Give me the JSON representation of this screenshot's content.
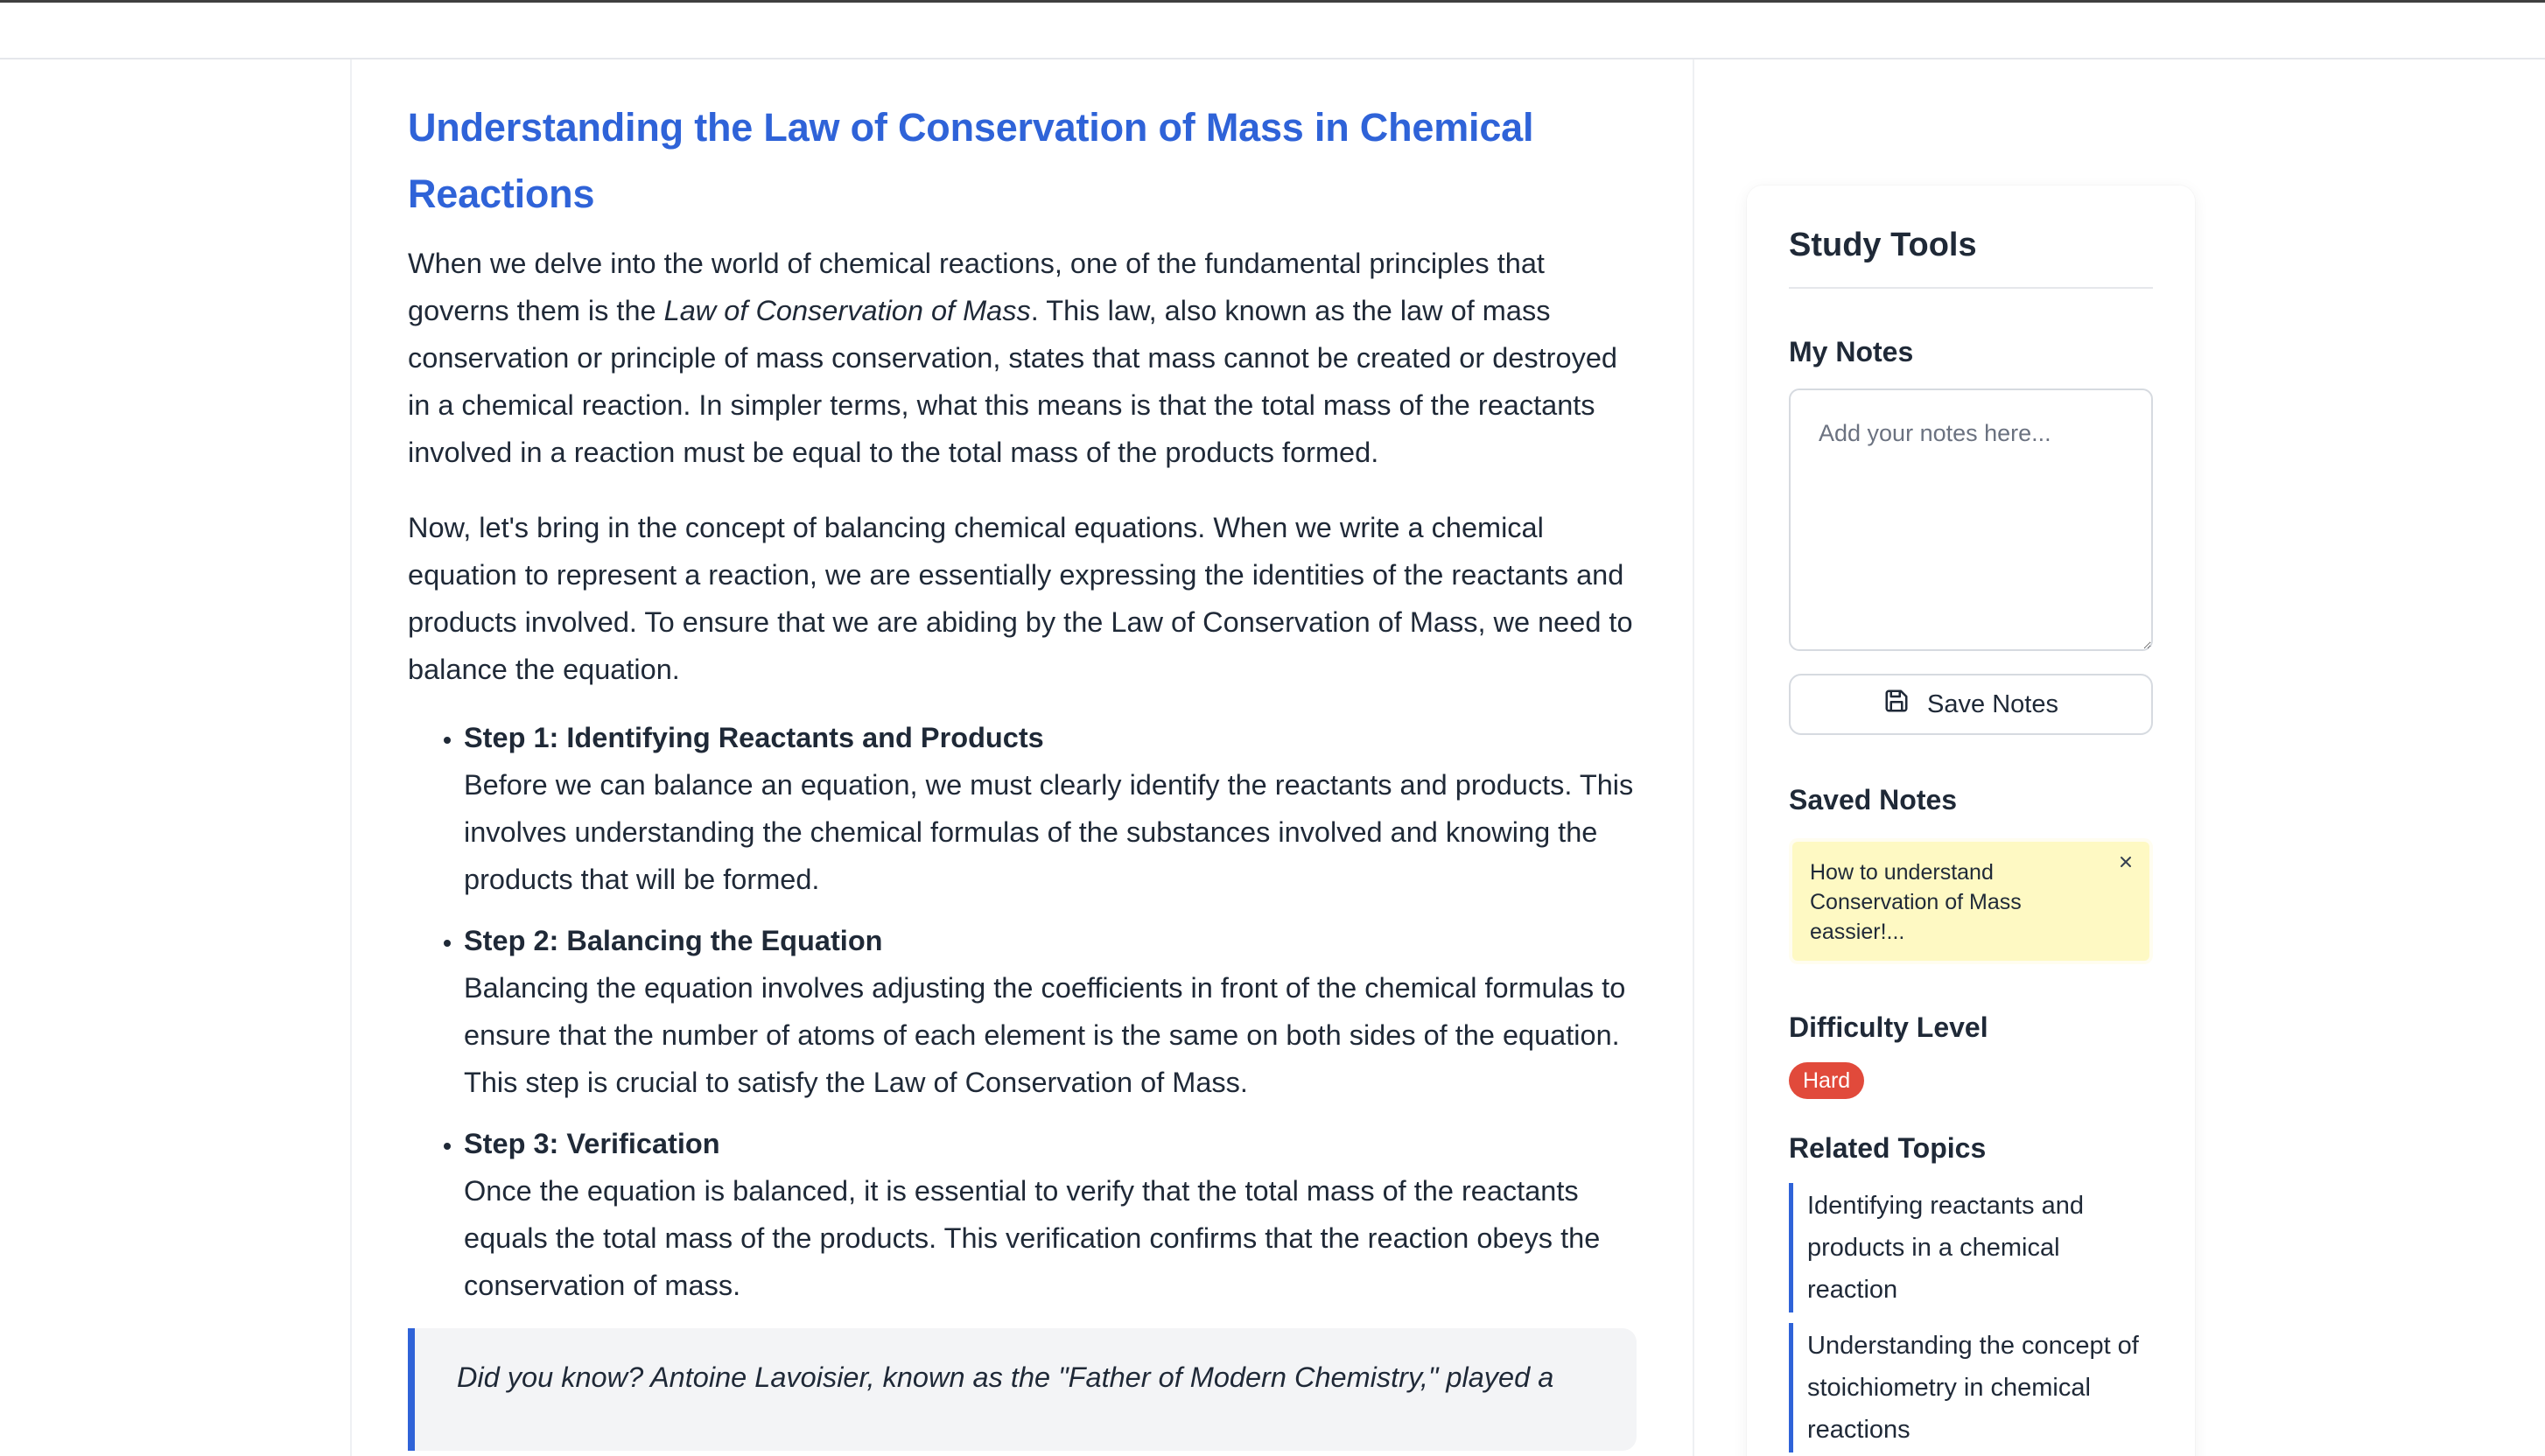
{
  "article": {
    "title": "Understanding the Law of Conservation of Mass in Chemical Reactions",
    "intro": {
      "before": "When we delve into the world of chemical reactions, one of the fundamental principles that governs them is the ",
      "emphasis": "Law of Conservation of Mass",
      "after": ". This law, also known as the law of mass conservation or principle of mass conservation, states that mass cannot be created or destroyed in a chemical reaction. In simpler terms, what this means is that the total mass of the reactants involved in a reaction must be equal to the total mass of the products formed."
    },
    "paragraph2": "Now, let's bring in the concept of balancing chemical equations. When we write a chemical equation to represent a reaction, we are essentially expressing the identities of the reactants and products involved. To ensure that we are abiding by the Law of Conservation of Mass, we need to balance the equation.",
    "steps": [
      {
        "title": "Step 1: Identifying Reactants and Products",
        "text": "Before we can balance an equation, we must clearly identify the reactants and products. This involves understanding the chemical formulas of the substances involved and knowing the products that will be formed."
      },
      {
        "title": "Step 2: Balancing the Equation",
        "text": "Balancing the equation involves adjusting the coefficients in front of the chemical formulas to ensure that the number of atoms of each element is the same on both sides of the equation. This step is crucial to satisfy the Law of Conservation of Mass."
      },
      {
        "title": "Step 3: Verification",
        "text": "Once the equation is balanced, it is essential to verify that the total mass of the reactants equals the total mass of the products. This verification confirms that the reaction obeys the conservation of mass."
      }
    ],
    "fact": "Did you know? Antoine Lavoisier, known as the \"Father of Modern Chemistry,\" played a"
  },
  "sidebar": {
    "title": "Study Tools",
    "notes": {
      "heading": "My Notes",
      "placeholder": "Add your notes here...",
      "save_label": "Save Notes",
      "save_icon": "save-icon"
    },
    "saved_notes": {
      "heading": "Saved Notes",
      "items": [
        {
          "text": "How to understand Conservation of Mass eassier!...",
          "close_icon": "close-icon"
        }
      ]
    },
    "difficulty": {
      "heading": "Difficulty Level",
      "value": "Hard",
      "color": "#e14a3b"
    },
    "related": {
      "heading": "Related Topics",
      "items": [
        {
          "label": "Identifying reactants and products in a chemical reaction"
        },
        {
          "label": "Understanding the concept of stoichiometry in chemical reactions"
        }
      ]
    }
  },
  "colors": {
    "accent": "#2f63d8",
    "note_background": "#fef9c3",
    "difficulty_hard": "#e14a3b"
  }
}
